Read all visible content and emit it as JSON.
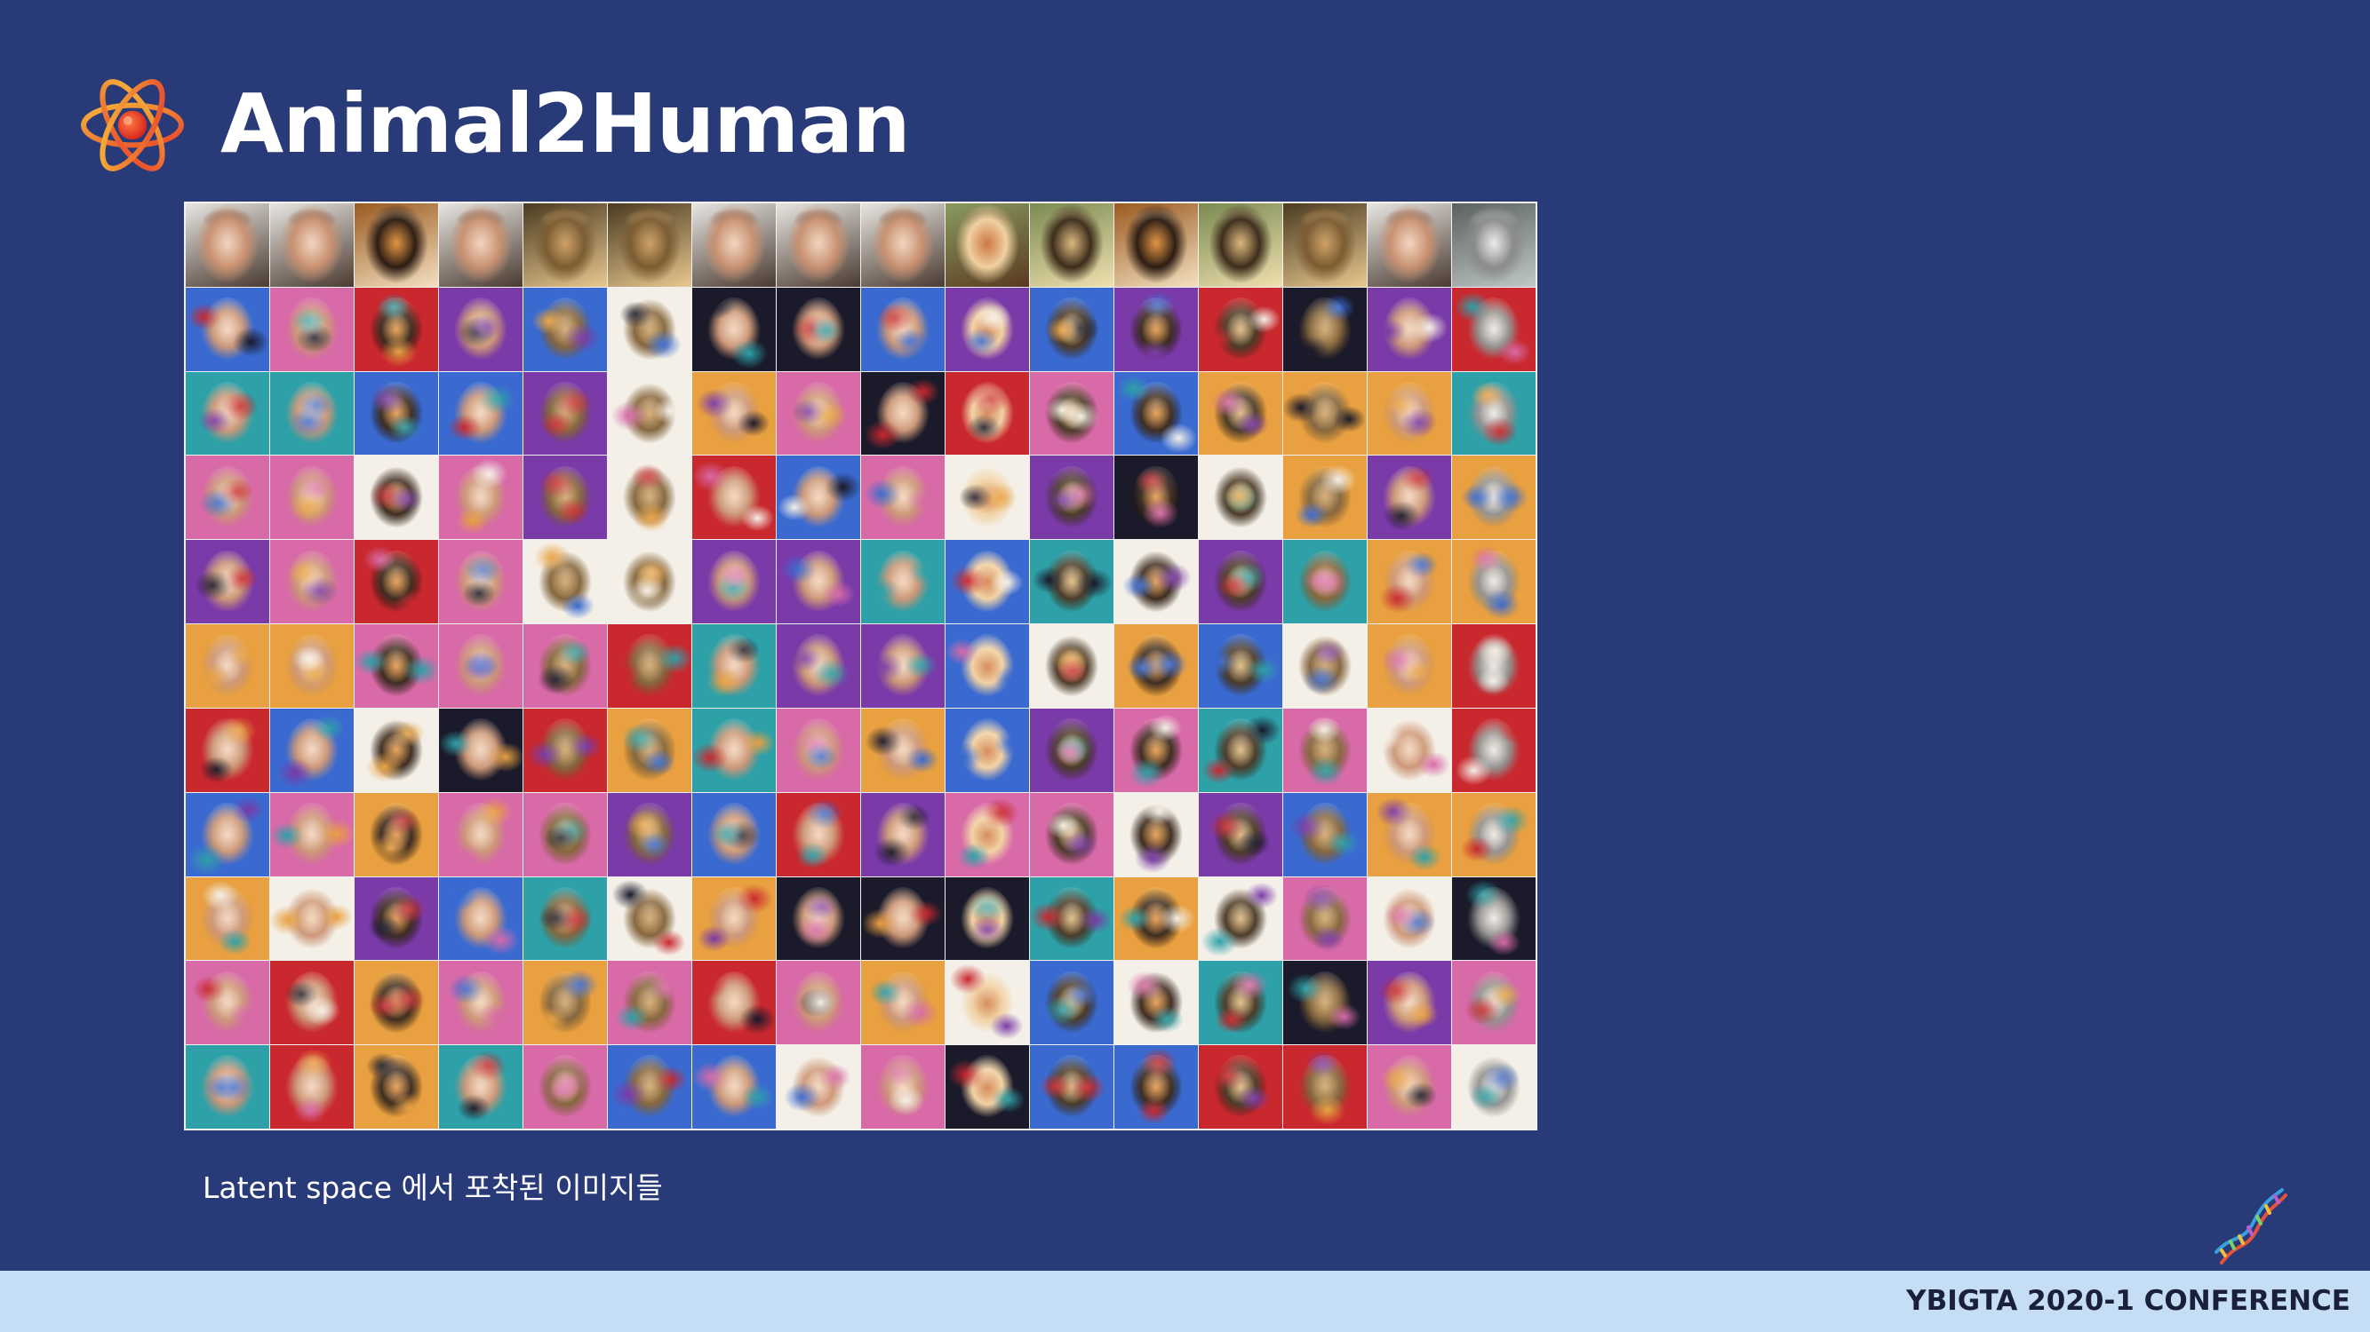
{
  "slide": {
    "title": "Animal2Human",
    "caption": "Latent space 에서 포착된 이미지들",
    "footer": "YBIGTA 2020-1 CONFERENCE"
  },
  "icons": {
    "logo": "atom-icon",
    "corner": "dna-icon"
  },
  "colors": {
    "background": "#283a78",
    "footer_bar": "#c6def5",
    "footer_text": "#1a1f3a",
    "title_text": "#ffffff"
  },
  "image_grid": {
    "columns": 16,
    "rows": 11,
    "source_row": [
      "human",
      "human",
      "tiger",
      "human",
      "lion",
      "lion",
      "human",
      "human",
      "human",
      "fox",
      "leopard",
      "tiger",
      "leopard",
      "lion",
      "human",
      "snow-leopard"
    ]
  }
}
